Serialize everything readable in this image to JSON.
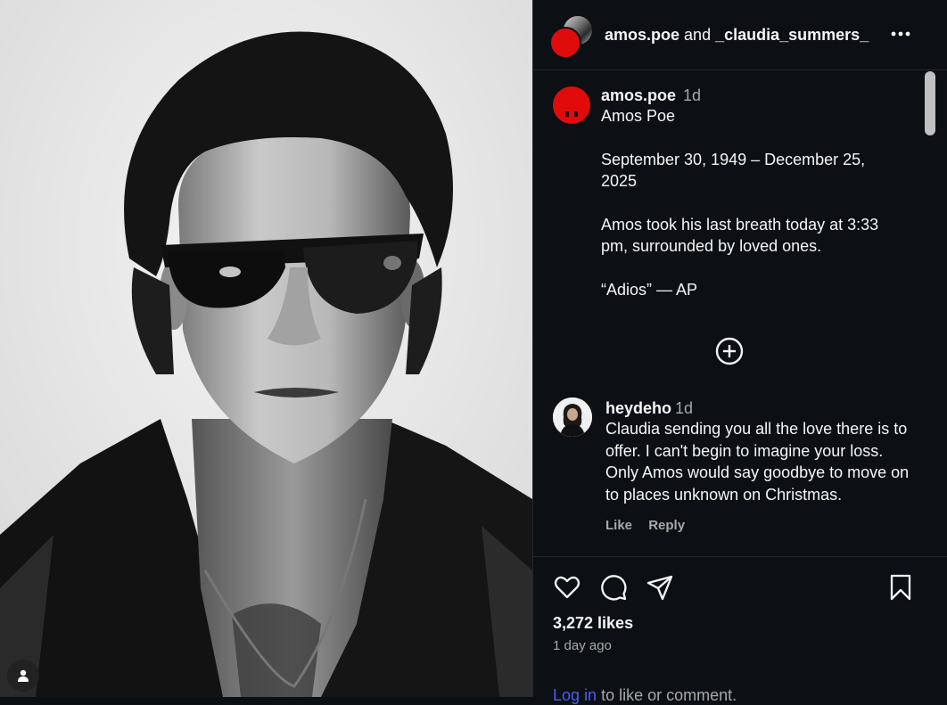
{
  "post": {
    "header": {
      "author": "amos.poe",
      "connector": "and",
      "collaborator": "_claudia_summers_"
    },
    "caption": {
      "username": "amos.poe",
      "time": "1d",
      "lines": [
        "Amos Poe",
        "",
        "September 30, 1949 – December 25, 2025",
        "",
        "Amos took his last breath today at 3:33 pm, surrounded by loved ones.",
        "",
        "“Adios” — AP"
      ]
    },
    "comments": [
      {
        "username": "heydeho",
        "time": "1d",
        "text": "Claudia sending you all the love there is to offer. I can't begin to imagine your loss. Only Amos would say goodbye to move on to places unknown on Christmas.",
        "like_label": "Like",
        "reply_label": "Reply"
      }
    ],
    "likes": "3,272 likes",
    "time_ago": "1 day ago",
    "login_prompt": {
      "link": "Log in",
      "rest": "to like or comment."
    }
  },
  "icons": {
    "more": "more-options-icon",
    "like": "heart-icon",
    "comment": "comment-icon",
    "share": "share-icon",
    "save": "bookmark-icon",
    "add": "add-circle-icon",
    "user_tag": "person-icon"
  },
  "colors": {
    "background": "#0c1014",
    "text": "#f5f5f5",
    "secondary_text": "#a8a8a8",
    "link": "#4a5df9",
    "avatar_red": "#e00b0b"
  }
}
